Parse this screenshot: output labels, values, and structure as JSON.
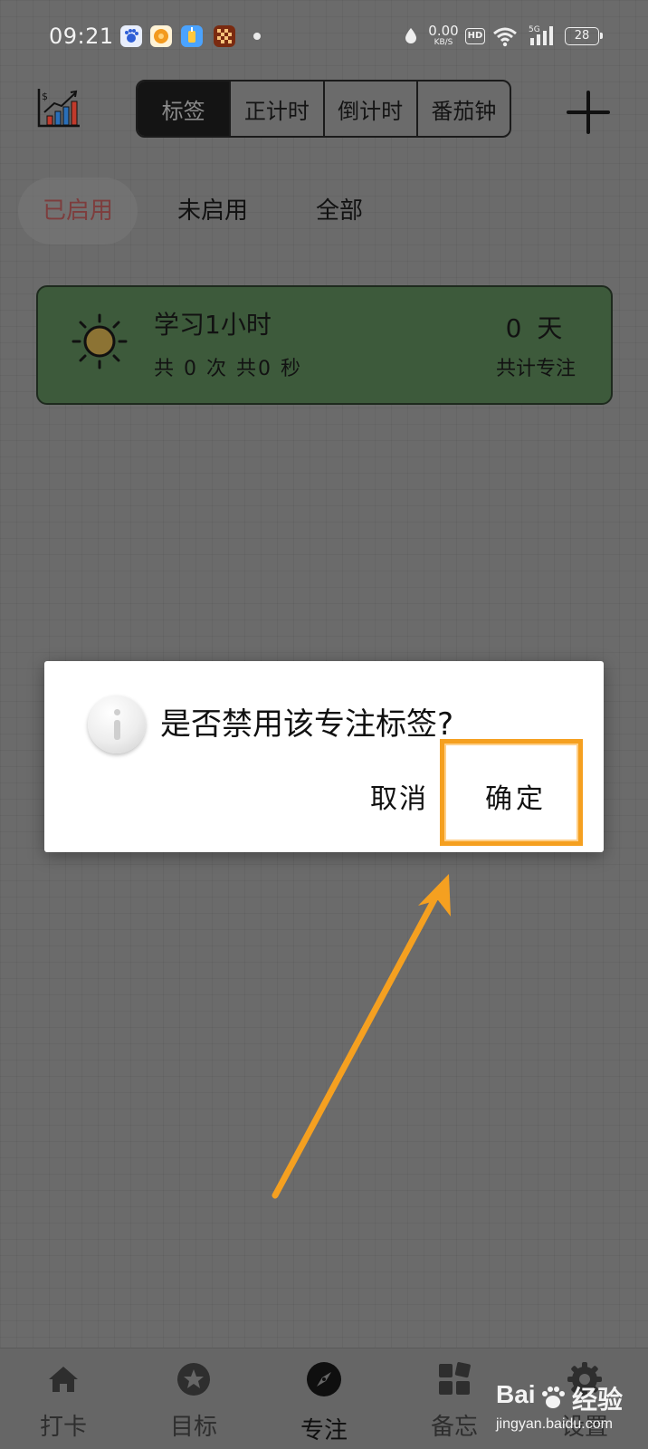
{
  "status_bar": {
    "time": "09:21",
    "net_speed_value": "0.00",
    "net_speed_unit": "KB/S",
    "hd_label": "HD",
    "network_label": "5G",
    "battery": "28"
  },
  "header": {
    "segments": [
      {
        "label": "标签",
        "active": true
      },
      {
        "label": "正计时",
        "active": false
      },
      {
        "label": "倒计时",
        "active": false
      },
      {
        "label": "番茄钟",
        "active": false
      }
    ]
  },
  "filters": [
    {
      "label": "已启用",
      "active": true
    },
    {
      "label": "未启用",
      "active": false
    },
    {
      "label": "全部",
      "active": false
    }
  ],
  "tag_card": {
    "title": "学习1小时",
    "count_text": "共 0 次   共0 秒",
    "days_text": "0 天",
    "total_label": "共计专注"
  },
  "dialog": {
    "message": "是否禁用该专注标签?",
    "cancel_label": "取消",
    "confirm_label": "确定"
  },
  "bottom_nav": [
    {
      "label": "打卡",
      "icon": "home-icon",
      "active": false
    },
    {
      "label": "目标",
      "icon": "star-icon",
      "active": false
    },
    {
      "label": "专注",
      "icon": "compass-icon",
      "active": true
    },
    {
      "label": "备忘",
      "icon": "grid-icon",
      "active": false
    },
    {
      "label": "设置",
      "icon": "gear-icon",
      "active": false
    }
  ],
  "watermark": {
    "logo_left": "Bai",
    "logo_right": "经验",
    "url": "jingyan.baidu.com"
  },
  "colors": {
    "overlay_background": "#6b6b6b",
    "card_green": "#3d5a3b",
    "active_filter_text": "#7d3d3d",
    "highlight": "#f5a020"
  }
}
